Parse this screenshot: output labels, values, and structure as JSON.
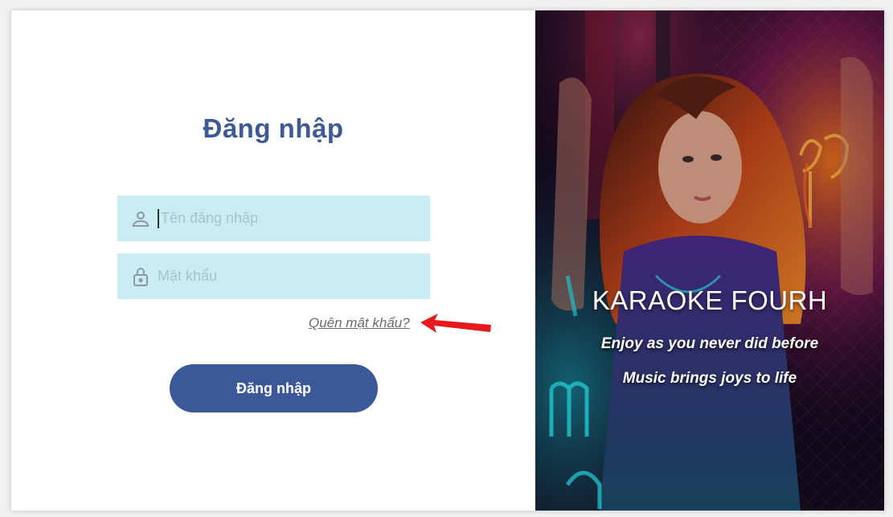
{
  "login": {
    "title": "Đăng nhập",
    "username_placeholder": "Tên đăng nhập",
    "password_placeholder": "Mật khẩu",
    "forgot_password": "Quên mật khẩu?",
    "submit_label": "Đăng nhập"
  },
  "hero": {
    "brand": "KARAOKE FOURH",
    "tagline_1": "Enjoy as you never did before",
    "tagline_2": "Music brings joys to life"
  },
  "icons": {
    "username": "user-icon",
    "password": "lock-icon",
    "annotation": "red-arrow-icon"
  },
  "colors": {
    "accent": "#3b5998",
    "title": "#3d5a96",
    "input_bg": "#c9edf2",
    "arrow": "#e8191d"
  }
}
